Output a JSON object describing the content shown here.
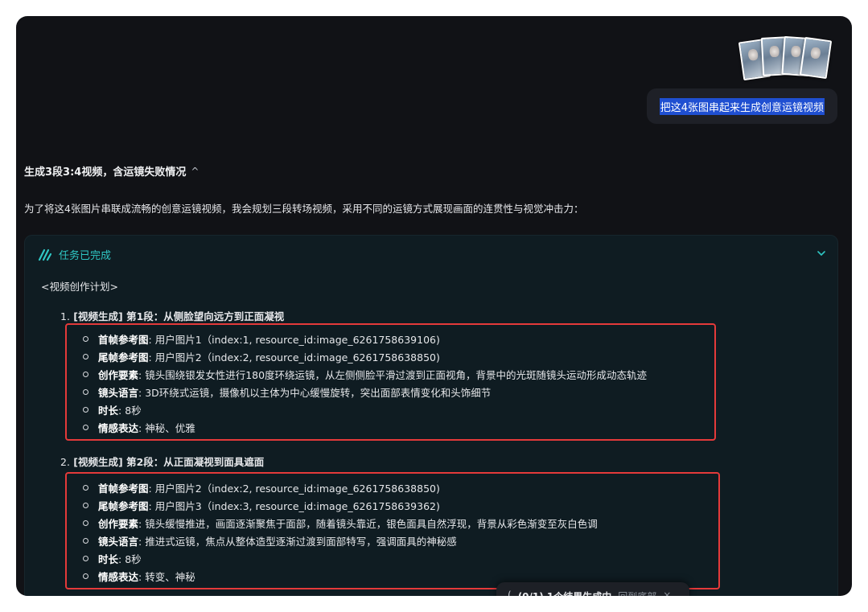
{
  "user": {
    "message": "把这4张图串起来生成创意运镜视频",
    "attachments": [
      "image-1",
      "image-2",
      "image-3",
      "image-4"
    ]
  },
  "assistant": {
    "status_text": "生成3段3:4视频，含运镜失败情况",
    "status_chevron": "^",
    "intro": "为了将这4张图片串联成流畅的创意运镜视频，我会规划三段转场视频，采用不同的运镜方式展现画面的连贯性与视觉冲击力：",
    "task": {
      "icon": "wave-icon",
      "title": "任务已完成",
      "plan_tag": "<视频创作计划>",
      "steps": [
        {
          "number": "1.",
          "title": "[视频生成] 第1段：从侧脸望向远方到正面凝视",
          "details": [
            {
              "key": "首帧参考图",
              "value": ": 用户图片1（index:1, resource_id:image_6261758639106)"
            },
            {
              "key": "尾帧参考图",
              "value": ": 用户图片2（index:2, resource_id:image_6261758638850)"
            },
            {
              "key": "创作要素",
              "value": ": 镜头围绕银发女性进行180度环绕运镜，从左侧侧脸平滑过渡到正面视角，背景中的光斑随镜头运动形成动态轨迹"
            },
            {
              "key": "镜头语言",
              "value": ": 3D环绕式运镜，摄像机以主体为中心缓慢旋转，突出面部表情变化和头饰细节"
            },
            {
              "key": "时长",
              "value": ": 8秒"
            },
            {
              "key": "情感表达",
              "value": ": 神秘、优雅"
            }
          ]
        },
        {
          "number": "2.",
          "title": "[视频生成] 第2段：从正面凝视到面具遮面",
          "details": [
            {
              "key": "首帧参考图",
              "value": ": 用户图片2（index:2, resource_id:image_6261758638850)"
            },
            {
              "key": "尾帧参考图",
              "value": ": 用户图片3（index:3, resource_id:image_6261758639362)"
            },
            {
              "key": "创作要素",
              "value": ": 镜头缓慢推进，画面逐渐聚焦于面部，随着镜头靠近，银色面具自然浮现，背景从彩色渐变至灰白色调"
            },
            {
              "key": "镜头语言",
              "value": ": 推进式运镜，焦点从整体造型逐渐过渡到面部特写，强调面具的神秘感"
            },
            {
              "key": "时长",
              "value": ": 8秒"
            },
            {
              "key": "情感表达",
              "value": ": 转变、神秘"
            }
          ]
        }
      ]
    }
  },
  "toast": {
    "spinner": "(",
    "text": "(0/1) 1个结果生成中",
    "link": "回到底部",
    "close": "×"
  },
  "colors": {
    "background": "#111216",
    "card": "#0f1c22",
    "accent": "#2fc7c4",
    "highlight": "#e43a3a",
    "selection": "#1f4fd1"
  }
}
